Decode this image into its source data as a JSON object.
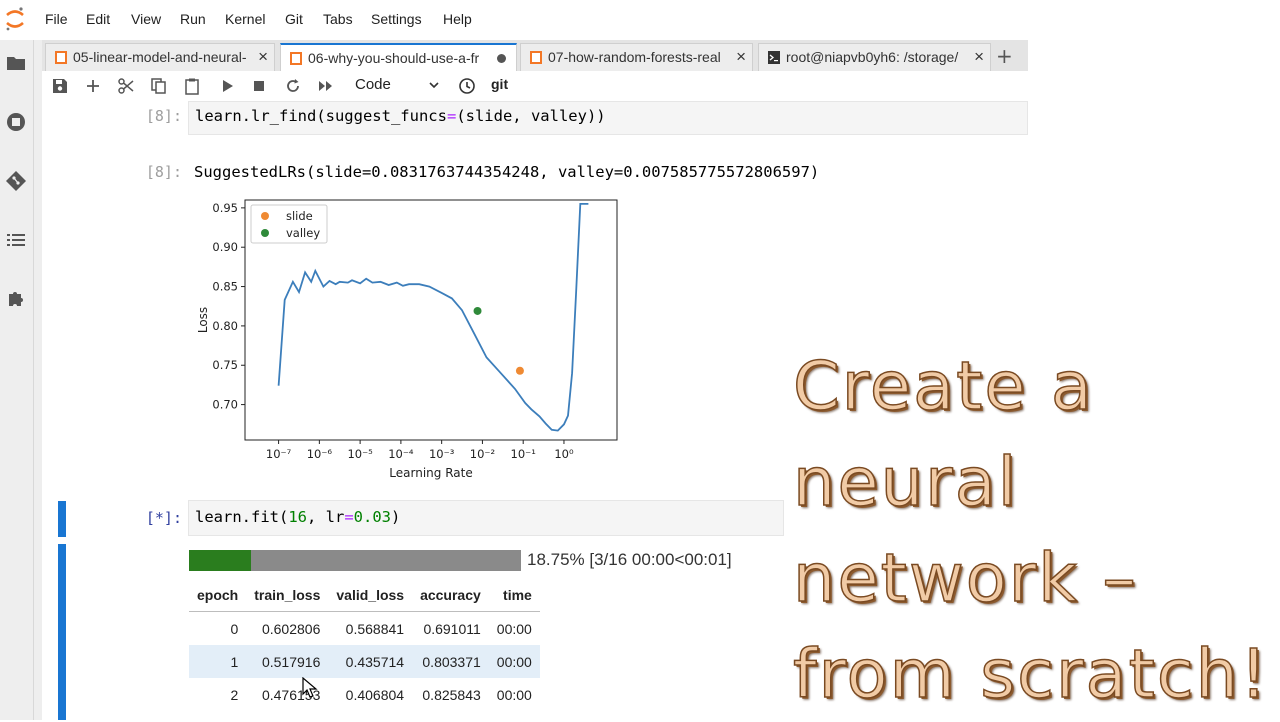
{
  "menubar": {
    "items": [
      "File",
      "Edit",
      "View",
      "Run",
      "Kernel",
      "Git",
      "Tabs",
      "Settings",
      "Help"
    ]
  },
  "tabs": [
    {
      "label": "05-linear-model-and-neural-",
      "icon": "notebook-icon",
      "state": "close"
    },
    {
      "label": "06-why-you-should-use-a-fr",
      "icon": "notebook-icon",
      "state": "modified"
    },
    {
      "label": "07-how-random-forests-real",
      "icon": "notebook-icon",
      "state": "close"
    },
    {
      "label": "root@niapvb0yh6: /storage/",
      "icon": "terminal-icon",
      "state": "close"
    }
  ],
  "toolbar": {
    "cell_type": "Code",
    "git_label": "git"
  },
  "cells": {
    "c1": {
      "prompt": "[8]:",
      "code_a": "learn.lr_find(suggest_funcs",
      "code_op": "=",
      "code_b": "(slide, valley))"
    },
    "o1": {
      "prompt": "[8]:",
      "text": "SuggestedLRs(slide=0.0831763744354248, valley=0.007585775572806597)"
    },
    "c2": {
      "prompt": "[*]:",
      "code_a": "learn.fit(",
      "num1": "16",
      "code_b": ", lr",
      "code_op": "=",
      "num2": "0.03",
      "code_c": ")"
    }
  },
  "chart_data": {
    "type": "line",
    "xlabel": "Learning Rate",
    "ylabel": "Loss",
    "xscale": "log",
    "xlim": [
      1.5e-08,
      20.0
    ],
    "ylim": [
      0.655,
      0.96
    ],
    "xticks": [
      -7,
      -6,
      -5,
      -4,
      -3,
      -2,
      -1,
      0
    ],
    "xtick_labels": [
      "10⁻⁷",
      "10⁻⁶",
      "10⁻⁵",
      "10⁻⁴",
      "10⁻³",
      "10⁻²",
      "10⁻¹",
      "10⁰"
    ],
    "yticks": [
      0.7,
      0.75,
      0.8,
      0.85,
      0.9,
      0.95
    ],
    "ytick_labels": [
      "0.70",
      "0.75",
      "0.80",
      "0.85",
      "0.90",
      "0.95"
    ],
    "series": [
      {
        "color": "#3c7ebb",
        "x_log10": [
          -7.0,
          -6.85,
          -6.65,
          -6.5,
          -6.35,
          -6.2,
          -6.1,
          -5.9,
          -5.75,
          -5.6,
          -5.5,
          -5.3,
          -5.2,
          -5.0,
          -4.85,
          -4.7,
          -4.5,
          -4.3,
          -4.1,
          -3.95,
          -3.8,
          -3.55,
          -3.3,
          -3.0,
          -2.75,
          -2.5,
          -2.2,
          -1.9,
          -1.6,
          -1.2,
          -0.95,
          -0.8,
          -0.6,
          -0.45,
          -0.3,
          -0.15,
          0.0,
          0.1,
          0.2,
          0.3,
          0.4,
          0.48,
          0.55,
          0.6
        ],
        "y": [
          0.724,
          0.833,
          0.856,
          0.843,
          0.868,
          0.856,
          0.87,
          0.85,
          0.857,
          0.853,
          0.856,
          0.855,
          0.858,
          0.854,
          0.86,
          0.855,
          0.856,
          0.852,
          0.855,
          0.851,
          0.853,
          0.853,
          0.85,
          0.842,
          0.835,
          0.82,
          0.79,
          0.76,
          0.743,
          0.72,
          0.702,
          0.694,
          0.685,
          0.676,
          0.668,
          0.667,
          0.675,
          0.686,
          0.74,
          0.845,
          0.955,
          0.955,
          0.955,
          0.955
        ]
      }
    ],
    "points": [
      {
        "name": "slide",
        "x": 0.0831763744354248,
        "y": 0.743,
        "color": "#ef8a33"
      },
      {
        "name": "valley",
        "x": 0.007585775572806597,
        "y": 0.819,
        "color": "#2f8a3a"
      }
    ],
    "legend": "top-left"
  },
  "progress": {
    "fraction": 0.1875,
    "text": "18.75% [3/16 00:00<00:01]"
  },
  "table": {
    "headers": [
      "epoch",
      "train_loss",
      "valid_loss",
      "accuracy",
      "time"
    ],
    "rows": [
      [
        "0",
        "0.602806",
        "0.568841",
        "0.691011",
        "00:00"
      ],
      [
        "1",
        "0.517916",
        "0.435714",
        "0.803371",
        "00:00"
      ],
      [
        "2",
        "0.476153",
        "0.406804",
        "0.825843",
        "00:00"
      ]
    ]
  },
  "overlay": {
    "lines": [
      "Create a",
      "neural",
      "network –",
      "from scratch!"
    ]
  }
}
